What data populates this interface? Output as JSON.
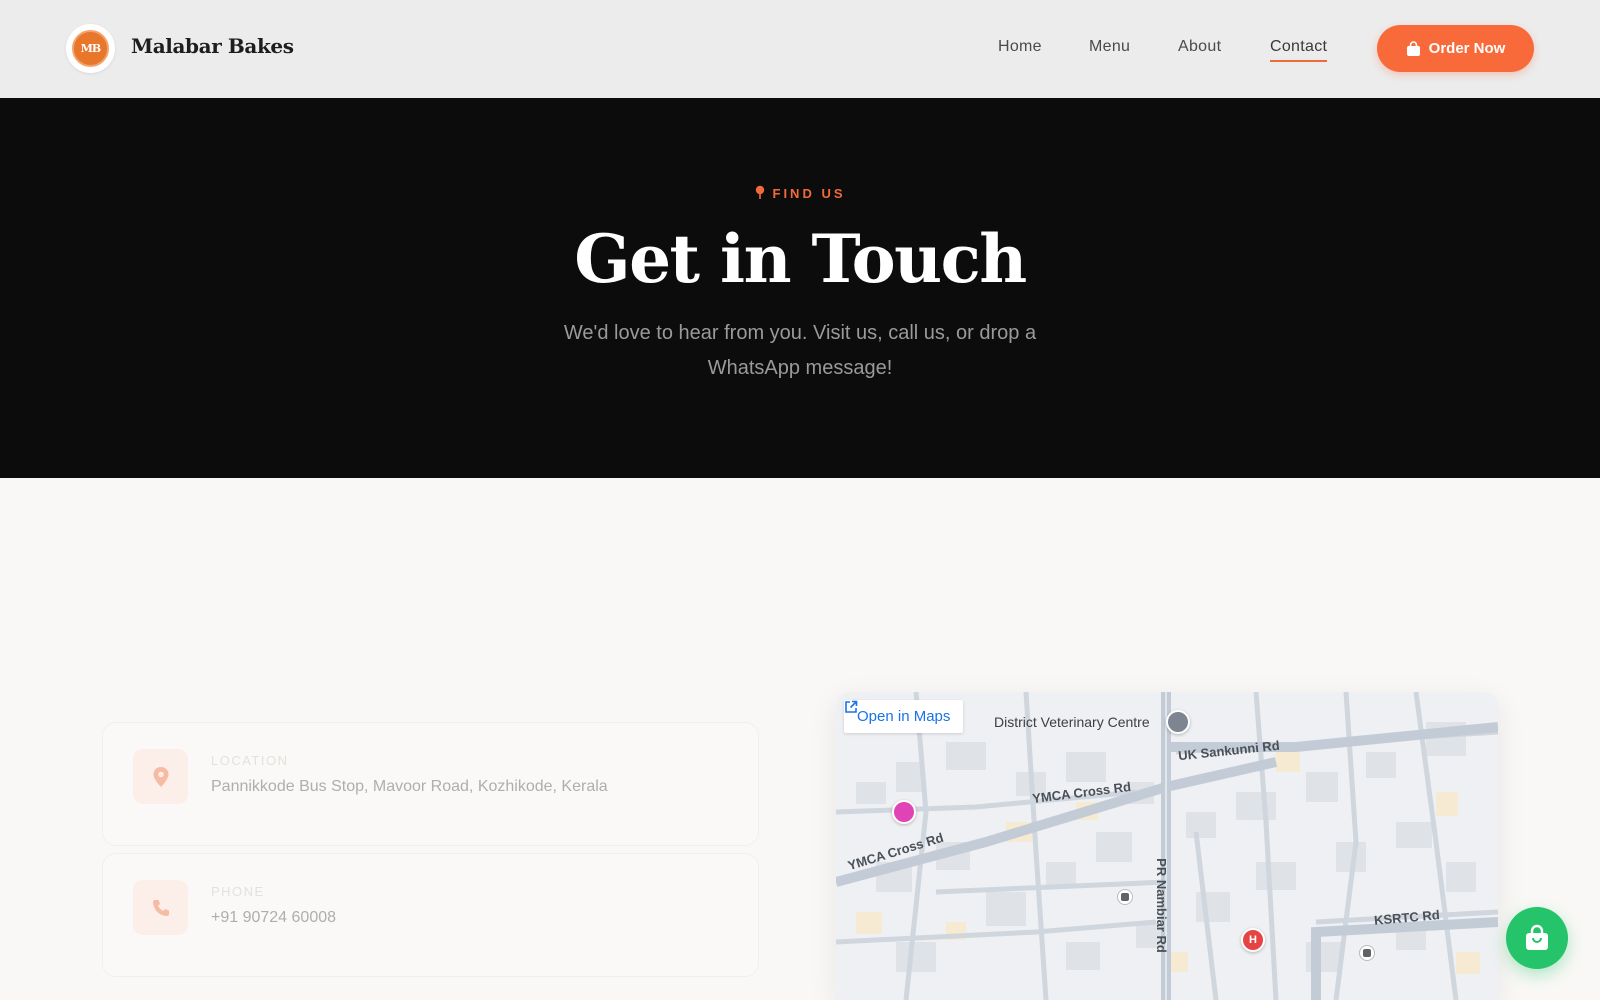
{
  "header": {
    "logo_text": "MB",
    "brand": "Malabar Bakes",
    "nav": [
      {
        "label": "Home",
        "active": false
      },
      {
        "label": "Menu",
        "active": false
      },
      {
        "label": "About",
        "active": false
      },
      {
        "label": "Contact",
        "active": true
      }
    ],
    "order_button": "Order Now"
  },
  "hero": {
    "eyebrow": "FIND US",
    "title": "Get in Touch",
    "subtitle": "We'd love to hear from you. Visit us, call us, or drop a WhatsApp message!"
  },
  "contact": {
    "location": {
      "label": "LOCATION",
      "value": "Pannikkode Bus Stop, Mavoor Road, Kozhikode, Kerala"
    },
    "phone": {
      "label": "PHONE",
      "value": "+91 90724 60008"
    }
  },
  "map": {
    "open_maps": "Open in Maps",
    "labels": {
      "vet": "District Veterinary Centre",
      "uk_sankunni": "UK Sankunni Rd",
      "ymca_1": "YMCA Cross Rd",
      "ymca_2": "YMCA Cross Rd",
      "pr_nambiar": "PR Nambiar Rd",
      "ksrtc": "KSRTC Rd"
    }
  },
  "colors": {
    "accent": "#f96a3a",
    "hero_bg": "#0c0c0c",
    "whatsapp_green": "#25c36a",
    "map_link": "#1a73e8"
  }
}
